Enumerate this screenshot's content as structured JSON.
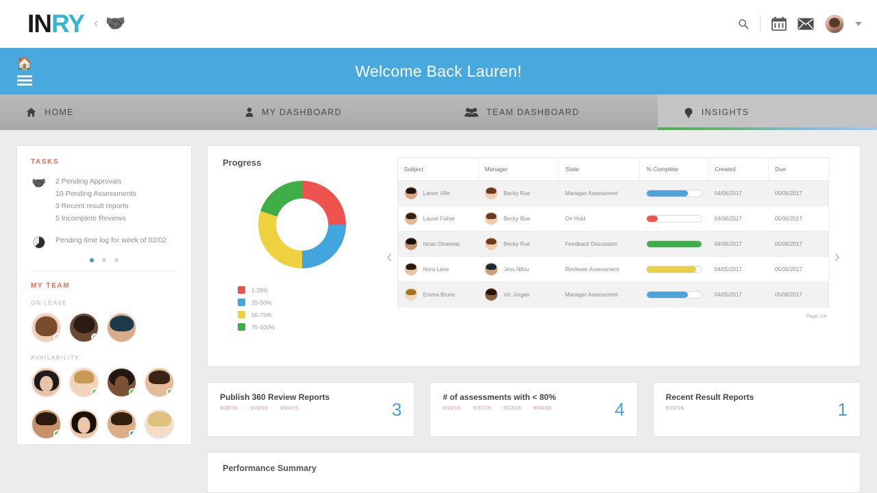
{
  "brand": {
    "part1": "IN",
    "part2": "RY",
    "chevron": "‹",
    "handshake_icon": "handshake-icon"
  },
  "topbar": {
    "search_icon": "search-icon",
    "calendar_icon": "calendar-icon",
    "mail_icon": "envelope-icon",
    "avatar": "user-avatar",
    "caret_icon": "chevron-down-icon"
  },
  "welcome": {
    "title": "Welcome Back Lauren!",
    "home_icon": "home-icon",
    "menu_icon": "hamburger-menu-icon"
  },
  "nav": {
    "tabs": [
      {
        "label": "HOME",
        "icon": "home-icon",
        "active": false
      },
      {
        "label": "MY DASHBOARD",
        "icon": "person-icon",
        "active": false
      },
      {
        "label": "TEAM DASHBOARD",
        "icon": "group-icon",
        "active": false
      },
      {
        "label": "INSIGHTS",
        "icon": "lightbulb-icon",
        "active": true
      }
    ]
  },
  "tasks": {
    "heading": "TASKS",
    "items": [
      "2 Pending Approvals",
      "10 Pending Assessments",
      "3 Recent result reports",
      "5 Incomplete Reviews"
    ],
    "timelog": "Pending time log for week of 02/02",
    "handshake_icon": "handshake-icon",
    "clock_icon": "pie-clock-icon"
  },
  "carousel": {
    "dots": 3,
    "active_index": 0
  },
  "team": {
    "heading": "MY TEAM",
    "on_leave_label": "ON LEAVE",
    "availability_label": "AVAILABILITY",
    "on_leave": [
      {
        "name": "team-member-1",
        "hair": "#7a4a2c",
        "skin": "#f0cdb4",
        "status": "grey"
      },
      {
        "name": "team-member-2",
        "hair": "#2b1b14",
        "skin": "#6b4a34",
        "status": "grey"
      },
      {
        "name": "team-member-3",
        "hair": "#1d3a4a",
        "skin": "#d9ab86",
        "status": "none"
      }
    ],
    "availability": [
      {
        "name": "team-member-4",
        "hair": "#1c1c1c",
        "skin": "#e8c3a8",
        "status": "none"
      },
      {
        "name": "team-member-5",
        "hair": "#c79a56",
        "skin": "#f2d3bb",
        "status": "green"
      },
      {
        "name": "team-member-6",
        "hair": "#231610",
        "skin": "#7a5336",
        "status": "green"
      },
      {
        "name": "team-member-7",
        "hair": "#3b2417",
        "skin": "#e4bb99",
        "status": "green"
      },
      {
        "name": "team-member-8",
        "hair": "#2a1a10",
        "skin": "#c79268",
        "status": "green"
      },
      {
        "name": "team-member-9",
        "hair": "#1a1008",
        "skin": "#ecc7ab",
        "status": "none"
      },
      {
        "name": "team-member-10",
        "hair": "#32200f",
        "skin": "#dcae86",
        "status": "blue"
      },
      {
        "name": "team-member-11",
        "hair": "#ddc27d",
        "skin": "#f5dcc6",
        "status": "none"
      }
    ]
  },
  "progress": {
    "title": "Progress",
    "prev_arrow": "‹",
    "next_arrow": "›",
    "pager": "Page 1/4"
  },
  "chart_data": {
    "type": "pie",
    "title": "Progress",
    "labels": [
      "1-25%",
      "25-50%",
      "50-75%",
      "75-100%"
    ],
    "values": [
      25,
      25,
      30,
      20
    ],
    "colors": [
      "#ef5350",
      "#42a5dd",
      "#efd140",
      "#3fae49"
    ],
    "legend_position": "bottom-left",
    "donut": true
  },
  "table": {
    "columns": [
      "Subject",
      "Manager",
      "State",
      "% Complete",
      "Created",
      "Due"
    ],
    "rows": [
      {
        "subject": "Lance Ville",
        "subject_hair": "#20140c",
        "subject_skin": "#d8a87e",
        "manager": "Becky Rue",
        "manager_hair": "#6b3a1f",
        "manager_skin": "#f0cbb0",
        "state": "Manager Assessment",
        "percent": 75,
        "bar_color": "#4fa3dd",
        "created": "04/06/2017",
        "due": "05/06/2017"
      },
      {
        "subject": "Laurel Fisher",
        "subject_hair": "#3a2316",
        "subject_skin": "#e3b896",
        "manager": "Becky Rue",
        "manager_hair": "#6b3a1f",
        "manager_skin": "#f0cbb0",
        "state": "On Hold",
        "percent": 20,
        "bar_color": "#f0584f",
        "created": "04/06/2017",
        "due": "05/06/2017"
      },
      {
        "subject": "Ishan Dhanwal",
        "subject_hair": "#15100c",
        "subject_skin": "#c69069",
        "manager": "Becky Rue",
        "manager_hair": "#6b3a1f",
        "manager_skin": "#f0cbb0",
        "state": "Feedback Discussion",
        "percent": 100,
        "bar_color": "#3fae49",
        "created": "04/06/2017",
        "due": "05/06/2017"
      },
      {
        "subject": "Nora Lane",
        "subject_hair": "#2a1a10",
        "subject_skin": "#ecc2a4",
        "manager": "Jess Nilou",
        "manager_hair": "#1b2a38",
        "manager_skin": "#cfa079",
        "state": "Reviewer Assessment",
        "percent": 90,
        "bar_color": "#e8cf49",
        "created": "04/05/2017",
        "due": "05/06/2017"
      },
      {
        "subject": "Emma Bruns",
        "subject_hair": "#a9741f",
        "subject_skin": "#f3d7bd",
        "manager": "Vic Jorgan",
        "manager_hair": "#241509",
        "manager_skin": "#8a5f3c",
        "state": "Manager Assessment",
        "percent": 75,
        "bar_color": "#4fa3dd",
        "created": "04/05/2017",
        "due": "05/06/2017"
      }
    ]
  },
  "kpis": [
    {
      "title": "Publish 360 Review Reports",
      "value": "3",
      "tags": [
        "9/20/16",
        "9/20/16",
        "9/04/16"
      ]
    },
    {
      "title": "# of assessments with < 80%",
      "value": "4",
      "tags": [
        "9/22/16",
        "9/22/16",
        "9/22/16",
        "9/04/16"
      ]
    },
    {
      "title": "Recent Result Reports",
      "value": "1",
      "tags": [
        "9/22/16"
      ]
    }
  ],
  "bottom": {
    "title": "Performance Summary"
  }
}
